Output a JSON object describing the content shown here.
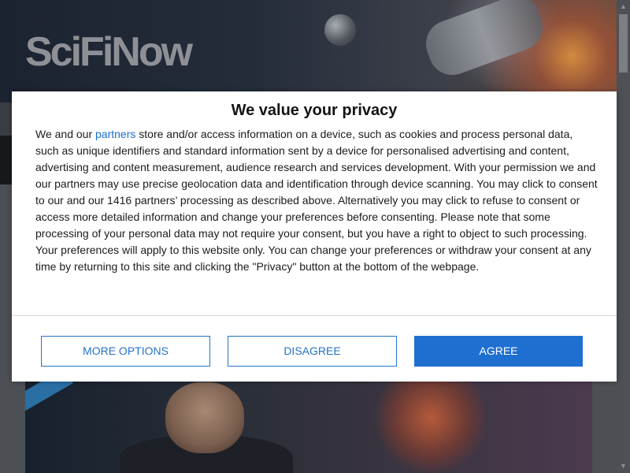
{
  "site": {
    "logo_text": "SciFiNow"
  },
  "consent": {
    "title": "We value your privacy",
    "body_before_link": "We and our ",
    "partners_link_label": "partners",
    "body_after_link": " store and/or access information on a device, such as cookies and process personal data, such as unique identifiers and standard information sent by a device for personalised advertising and content, advertising and content measurement, audience research and services development. With your permission we and our partners may use precise geolocation data and identification through device scanning. You may click to consent to our and our 1416 partners’ processing as described above. Alternatively you may click to refuse to consent or access more detailed information and change your preferences before consenting. Please note that some processing of your personal data may not require your consent, but you have a right to object to such processing. Your preferences will apply to this website only. You can change your preferences or withdraw your consent at any time by returning to this site and clicking the \"Privacy\" button at the bottom of the webpage.",
    "buttons": {
      "more_options_label": "MORE OPTIONS",
      "disagree_label": "DISAGREE",
      "agree_label": "AGREE"
    }
  },
  "scrollbar": {
    "up_arrow_icon": "▲",
    "down_arrow_icon": "▼"
  },
  "colors": {
    "accent": "#1f6fd0",
    "link": "#1a6fd1",
    "overlay_dim": "#4a4d52"
  }
}
